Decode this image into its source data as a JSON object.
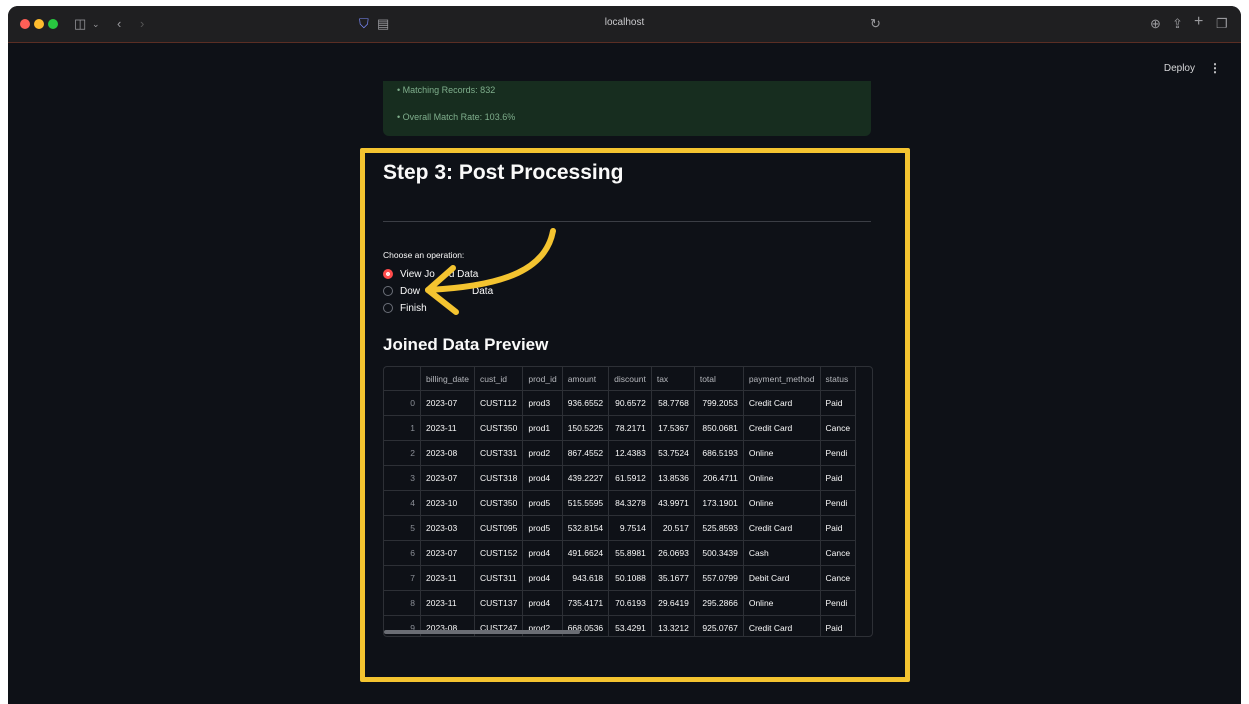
{
  "browser": {
    "url": "localhost"
  },
  "header": {
    "deploy_label": "Deploy",
    "menu_icon": "kebab-menu-icon"
  },
  "summary": {
    "matching_records": "• Matching Records: 832",
    "match_rate": "• Overall Match Rate: 103.6%"
  },
  "step": {
    "title": "Step 3: Post Processing"
  },
  "operation": {
    "label": "Choose an operation:",
    "options": [
      "View Joined Data",
      "Download Joined Data",
      "Finish"
    ],
    "options_visible": [
      "View Jo",
      "d Data",
      "Dow",
      "Data",
      "Finish"
    ],
    "selected": "View Joined Data"
  },
  "preview": {
    "title": "Joined Data Preview",
    "columns": [
      "billing_date",
      "cust_id",
      "prod_id",
      "amount",
      "discount",
      "tax",
      "total",
      "payment_method",
      "status"
    ],
    "rows": [
      [
        "0",
        "2023-07",
        "CUST112",
        "prod3",
        "936.6552",
        "90.6572",
        "58.7768",
        "799.2053",
        "Credit Card",
        "Paid"
      ],
      [
        "1",
        "2023-11",
        "CUST350",
        "prod1",
        "150.5225",
        "78.2171",
        "17.5367",
        "850.0681",
        "Credit Card",
        "Cance"
      ],
      [
        "2",
        "2023-08",
        "CUST331",
        "prod2",
        "867.4552",
        "12.4383",
        "53.7524",
        "686.5193",
        "Online",
        "Pendi"
      ],
      [
        "3",
        "2023-07",
        "CUST318",
        "prod4",
        "439.2227",
        "61.5912",
        "13.8536",
        "206.4711",
        "Online",
        "Paid"
      ],
      [
        "4",
        "2023-10",
        "CUST350",
        "prod5",
        "515.5595",
        "84.3278",
        "43.9971",
        "173.1901",
        "Online",
        "Pendi"
      ],
      [
        "5",
        "2023-03",
        "CUST095",
        "prod5",
        "532.8154",
        "9.7514",
        "20.517",
        "525.8593",
        "Credit Card",
        "Paid"
      ],
      [
        "6",
        "2023-07",
        "CUST152",
        "prod4",
        "491.6624",
        "55.8981",
        "26.0693",
        "500.3439",
        "Cash",
        "Cance"
      ],
      [
        "7",
        "2023-11",
        "CUST311",
        "prod4",
        "943.618",
        "50.1088",
        "35.1677",
        "557.0799",
        "Debit Card",
        "Cance"
      ],
      [
        "8",
        "2023-11",
        "CUST137",
        "prod4",
        "735.4171",
        "70.6193",
        "29.6419",
        "295.2866",
        "Online",
        "Pendi"
      ],
      [
        "9",
        "2023-08",
        "CUST247",
        "prod2",
        "668.0536",
        "53.4291",
        "13.3212",
        "925.0767",
        "Credit Card",
        "Paid"
      ]
    ]
  },
  "colors": {
    "highlight": "#f4c430",
    "radio_selected": "#ff4b4b",
    "background": "#0e1117"
  }
}
